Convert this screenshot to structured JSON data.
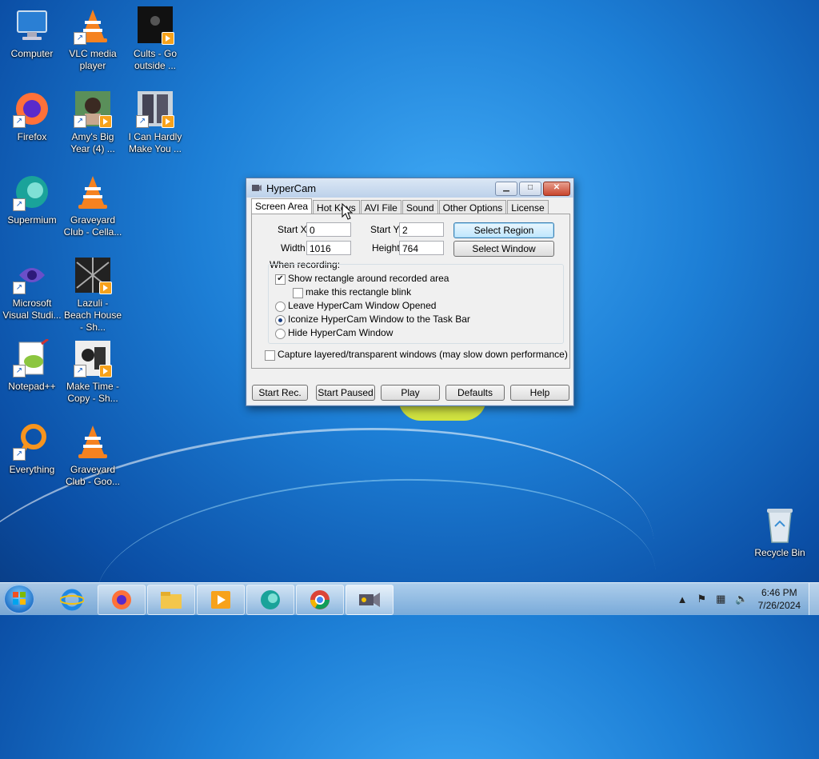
{
  "desktop_icons": [
    {
      "label": "Computer",
      "icon": "computer-icon"
    },
    {
      "label": "VLC media player",
      "icon": "vlc-icon"
    },
    {
      "label": "Cults - Go outside ...",
      "icon": "video-thumbnail-icon"
    },
    {
      "label": "Firefox",
      "icon": "firefox-icon"
    },
    {
      "label": "Amy's Big Year (4) ...",
      "icon": "video-thumbnail-icon"
    },
    {
      "label": "I Can Hardly Make You ...",
      "icon": "video-thumbnail-icon"
    },
    {
      "label": "Supermium",
      "icon": "supermium-icon"
    },
    {
      "label": "Graveyard Club - Cella...",
      "icon": "vlc-icon"
    },
    {
      "label": "Microsoft Visual Studi...",
      "icon": "visual-studio-icon"
    },
    {
      "label": "Lazuli - Beach House - Sh...",
      "icon": "video-thumbnail-icon"
    },
    {
      "label": "Notepad++",
      "icon": "notepadpp-icon"
    },
    {
      "label": "Make Time - Copy - Sh...",
      "icon": "video-thumbnail-icon"
    },
    {
      "label": "Everything",
      "icon": "everything-icon"
    },
    {
      "label": "Graveyard Club - Goo...",
      "icon": "vlc-icon"
    },
    {
      "label": "Recycle Bin",
      "icon": "recycle-bin-icon"
    }
  ],
  "window": {
    "title": "HyperCam",
    "tabs": [
      "Screen Area",
      "Hot Keys",
      "AVI File",
      "Sound",
      "Other Options",
      "License"
    ],
    "active_tab": "Screen Area",
    "start_x_label": "Start X",
    "start_x": "0",
    "start_y_label": "Start Y",
    "start_y": "2",
    "width_label": "Width",
    "width": "1016",
    "height_label": "Height",
    "height": "764",
    "select_region": "Select Region",
    "select_window": "Select Window",
    "when_recording": "When recording:",
    "show_rect": "Show rectangle around recorded area",
    "show_rect_checked": true,
    "blink": "make this rectangle blink",
    "blink_checked": false,
    "radio_leave": "Leave HyperCam Window Opened",
    "radio_iconize": "Iconize HyperCam Window to the Task Bar",
    "radio_hide": "Hide HyperCam Window",
    "selected_radio": "Iconize HyperCam Window to the Task Bar",
    "capture_layered": "Capture layered/transparent windows (may slow down performance)",
    "capture_layered_checked": false,
    "buttons": [
      "Start Rec.",
      "Start Paused",
      "Play",
      "Defaults",
      "Help"
    ]
  },
  "taskbar": {
    "pinned": [
      "internet-explorer-icon",
      "firefox-icon",
      "file-explorer-icon",
      "media-player-icon",
      "supermium-icon",
      "chrome-icon",
      "hypercam-icon"
    ],
    "time": "6:46 PM",
    "date": "7/26/2024"
  },
  "colors": {
    "accent": "#1d7fd6",
    "taskbar": "#b4d2ee",
    "button_focus": "#bee6fd"
  }
}
